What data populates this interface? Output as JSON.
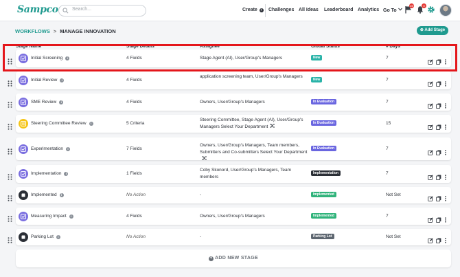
{
  "app": {
    "logo": "Sampcom"
  },
  "search": {
    "placeholder": "Search..."
  },
  "nav": {
    "create": "Create",
    "challenges": "Challenges",
    "all_ideas": "All Ideas",
    "leaderboard": "Leaderboard",
    "analytics": "Analytics",
    "go_to": "Go To",
    "flag_badge": "10",
    "bell_badge": "4"
  },
  "breadcrumb": {
    "root": "WORKFLOWS",
    "separator": ">",
    "current": "MANAGE INNOVATION"
  },
  "add_stage_label": "Add Stage",
  "columns": {
    "stage_name": "Stage Name",
    "stage_details": "Stage Details",
    "assignee": "Assignee",
    "global_status": "Global Status",
    "days": "# Days"
  },
  "colors": {
    "accent": "#1f9a8f",
    "stage_icon_purple": "#7b6fe0",
    "stage_icon_yellow": "#f5c518",
    "stage_icon_dark": "#2b2f36",
    "status_new": "#2ab3a8",
    "status_in_evaluation": "#6a66e0",
    "status_implementation": "#2b2f36",
    "status_implemented": "#2fb37a",
    "status_parking_lot": "#5d6670",
    "highlight": "#e4161b"
  },
  "stages": [
    {
      "name": "Initial Screening",
      "icon": "check-square-icon",
      "details": "4 Fields",
      "assignee": "Stage Agent (AI), User/Group's Managers",
      "status": "New",
      "days": "7"
    },
    {
      "name": "Initial Review",
      "icon": "check-square-icon",
      "details": "4 Fields",
      "assignee": "application screening team, User/Group's Managers",
      "status": "New",
      "days": "7"
    },
    {
      "name": "SME Review",
      "icon": "check-square-icon",
      "details": "4 Fields",
      "assignee": "Owners, User/Group's Managers",
      "status": "In Evaluation",
      "days": "7"
    },
    {
      "name": "Steering Committee Review",
      "icon": "criteria-icon",
      "details": "5 Criteria",
      "assignee": "Steering Committee, Stage Agent (AI), User/Group's Managers Select Your Department",
      "status": "In Evaluation",
      "days": "15"
    },
    {
      "name": "Experimentation",
      "icon": "check-square-icon",
      "details": "7 Fields",
      "assignee": "Owners, User/Group's Managers, Team members, Submitters and Co-submitters Select Your Department",
      "status": "In Evaluation",
      "days": "7"
    },
    {
      "name": "Implementation",
      "icon": "check-square-icon",
      "details": "1 Fields",
      "assignee": "Coby Skonord, User/Group's Managers, Team members",
      "status": "Implementation",
      "days": "7"
    },
    {
      "name": "Implemented",
      "icon": "stop-icon",
      "details": "No Action",
      "assignee": "-",
      "status": "Implemented",
      "days": "Not Set"
    },
    {
      "name": "Measuring Impact",
      "icon": "check-square-icon",
      "details": "4 Fields",
      "assignee": "Owners, User/Group's Managers",
      "status": "Implemented",
      "days": "7"
    },
    {
      "name": "Parking Lot",
      "icon": "stop-icon",
      "details": "No Action",
      "assignee": "-",
      "status": "Parking Lot",
      "days": "Not Set"
    }
  ],
  "add_new_stage_label": "ADD NEW STAGE"
}
